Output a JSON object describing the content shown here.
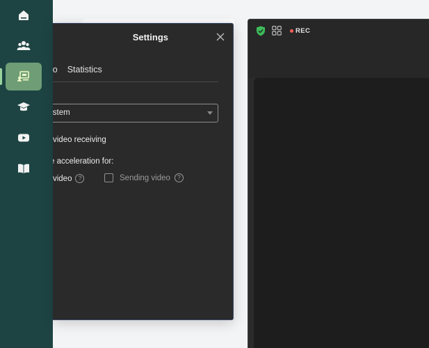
{
  "nav": {
    "items": [
      {
        "icon": "home-icon"
      },
      {
        "icon": "people-icon"
      },
      {
        "icon": "meeting-screen-icon",
        "active": true
      },
      {
        "icon": "graduation-cap-icon"
      },
      {
        "icon": "youtube-play-icon"
      },
      {
        "icon": "book-icon"
      }
    ],
    "active_color": "#6f9e76",
    "background": "#1d4443"
  },
  "dialog": {
    "title": "Settings",
    "tabs": [
      "dio",
      "Statistics"
    ],
    "select": {
      "value": "ystem"
    },
    "video_receiving_label": "video receiving",
    "hw_accel_label": "e acceleration for:",
    "receiving_video_label": "ng video",
    "sending_video_label": "Sending video",
    "help_glyph": "?"
  },
  "meeting": {
    "rec_label": "REC",
    "shield_color": "#3dbb5a",
    "rec_color": "#ff5f57"
  }
}
